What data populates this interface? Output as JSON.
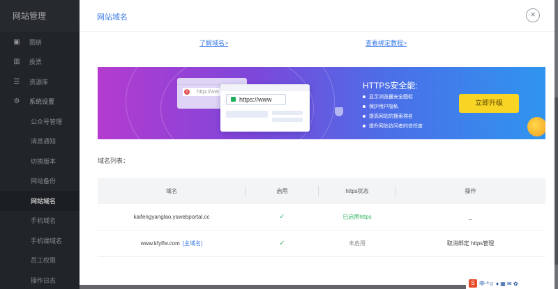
{
  "sidebar": {
    "title": "网站管理",
    "items": [
      {
        "label": "图册",
        "icon": "image-icon"
      },
      {
        "label": "投票",
        "icon": "bar-chart-icon"
      },
      {
        "label": "资源库",
        "icon": "database-icon"
      },
      {
        "label": "系统设置",
        "icon": "gear-icon"
      },
      {
        "label": "公众号管理"
      },
      {
        "label": "消息通知"
      },
      {
        "label": "切换版本"
      },
      {
        "label": "网站备份"
      },
      {
        "label": "网站域名"
      },
      {
        "label": "手机域名"
      },
      {
        "label": "手机端域名"
      },
      {
        "label": "员工权限"
      },
      {
        "label": "操作日志"
      }
    ]
  },
  "panel": {
    "title": "网站域名",
    "close_icon": "×",
    "link_learn": "了解域名>",
    "link_tutorial": "查看绑定教程>"
  },
  "banner": {
    "heading": "HTTPS安全能:",
    "features": [
      "显示浏览器安全图标",
      "保护用户隐私",
      "提高网站的搜索排名",
      "提升网站访问者的信任度"
    ],
    "url_old": "http://ww",
    "url_new": "https://www",
    "upgrade_label": "立即升级"
  },
  "list_label": "域名列表：",
  "table": {
    "headers": [
      "域名",
      "启用",
      "https状态",
      "操作"
    ],
    "rows": [
      {
        "domain": "kaifengyanglao.yswebportal.cc",
        "tag": "",
        "enabled": "✓",
        "https": "已启用https",
        "action": "_"
      },
      {
        "domain": "www.kfylfw.com",
        "tag": "[主域名]",
        "enabled": "✓",
        "https": "未启用",
        "action": "取消绑定  https管理"
      }
    ]
  },
  "tray": {
    "ime": "S",
    "text": "中·º☺ ♦ ▦ ✉ ✿"
  }
}
